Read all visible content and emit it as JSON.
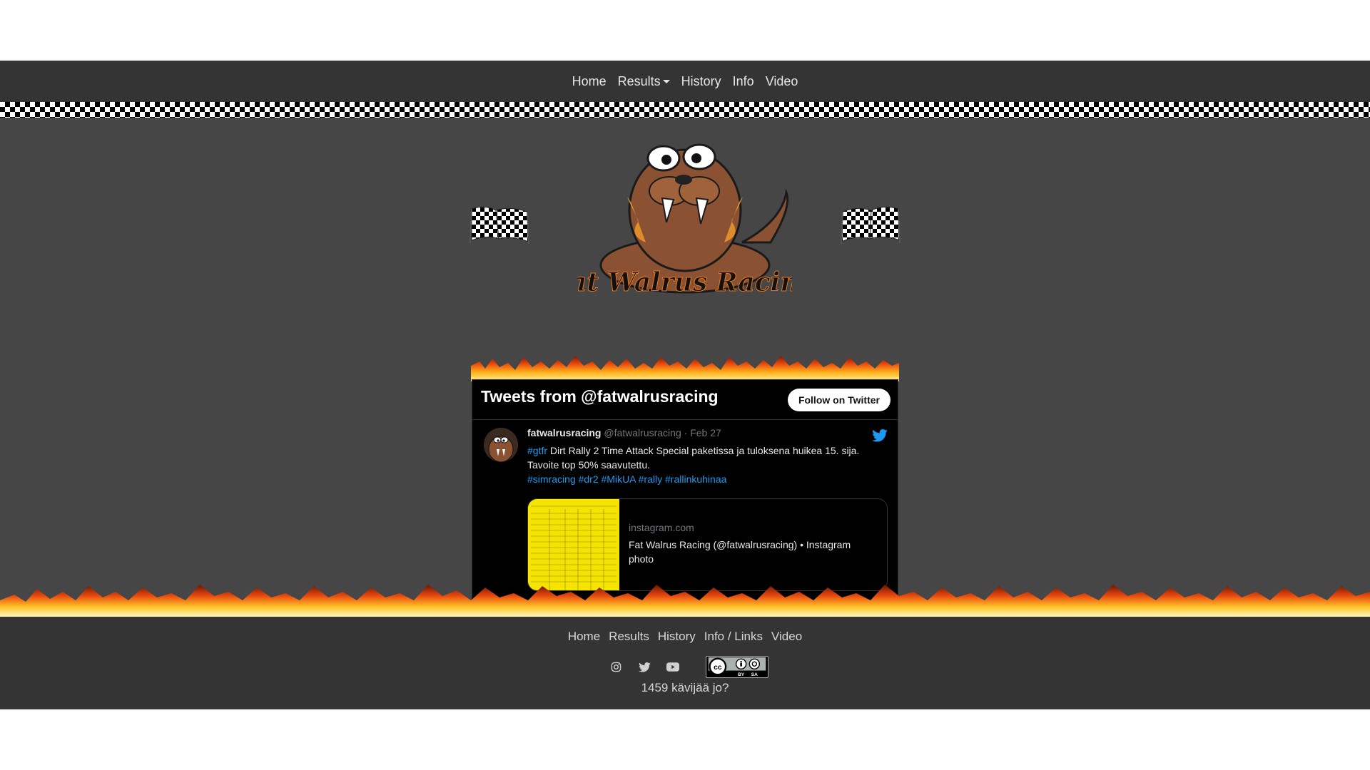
{
  "nav": {
    "home": "Home",
    "results": "Results",
    "history": "History",
    "info": "Info",
    "video": "Video"
  },
  "logo": {
    "text": "Fat Walrus Racing",
    "icon": "walrus-logo"
  },
  "twitter": {
    "title": "Tweets from @fatwalrusracing",
    "follow_label": "Follow on Twitter",
    "tweet": {
      "name": "fatwalrusracing",
      "handle": "@fatwalrusracing",
      "separator": "·",
      "date": "Feb 27",
      "hashtag_first": "#gtfr",
      "text": " Dirt Rally 2 Time Attack Special paketissa ja tuloksena huikea 15. sija. Tavoite top 50% saavutettu.",
      "hashtags": [
        "#simracing",
        "#dr2",
        "#MikUA",
        "#rally",
        "#rallinkuhinaa"
      ],
      "card": {
        "domain": "instagram.com",
        "title": "Fat Walrus Racing (@fatwalrusracing) • Instagram photo"
      }
    }
  },
  "footer": {
    "home": "Home",
    "results": "Results",
    "history": "History",
    "info": "Info / Links",
    "video": "Video",
    "icons": [
      "instagram-icon",
      "twitter-icon",
      "youtube-icon",
      "cc-by-sa-badge"
    ],
    "visitors": "1459 kävijää jo?"
  },
  "colors": {
    "nav_bg": "#343434",
    "main_bg": "#464646",
    "twitter_bg": "#000000",
    "link_blue": "#1d9bf0"
  }
}
